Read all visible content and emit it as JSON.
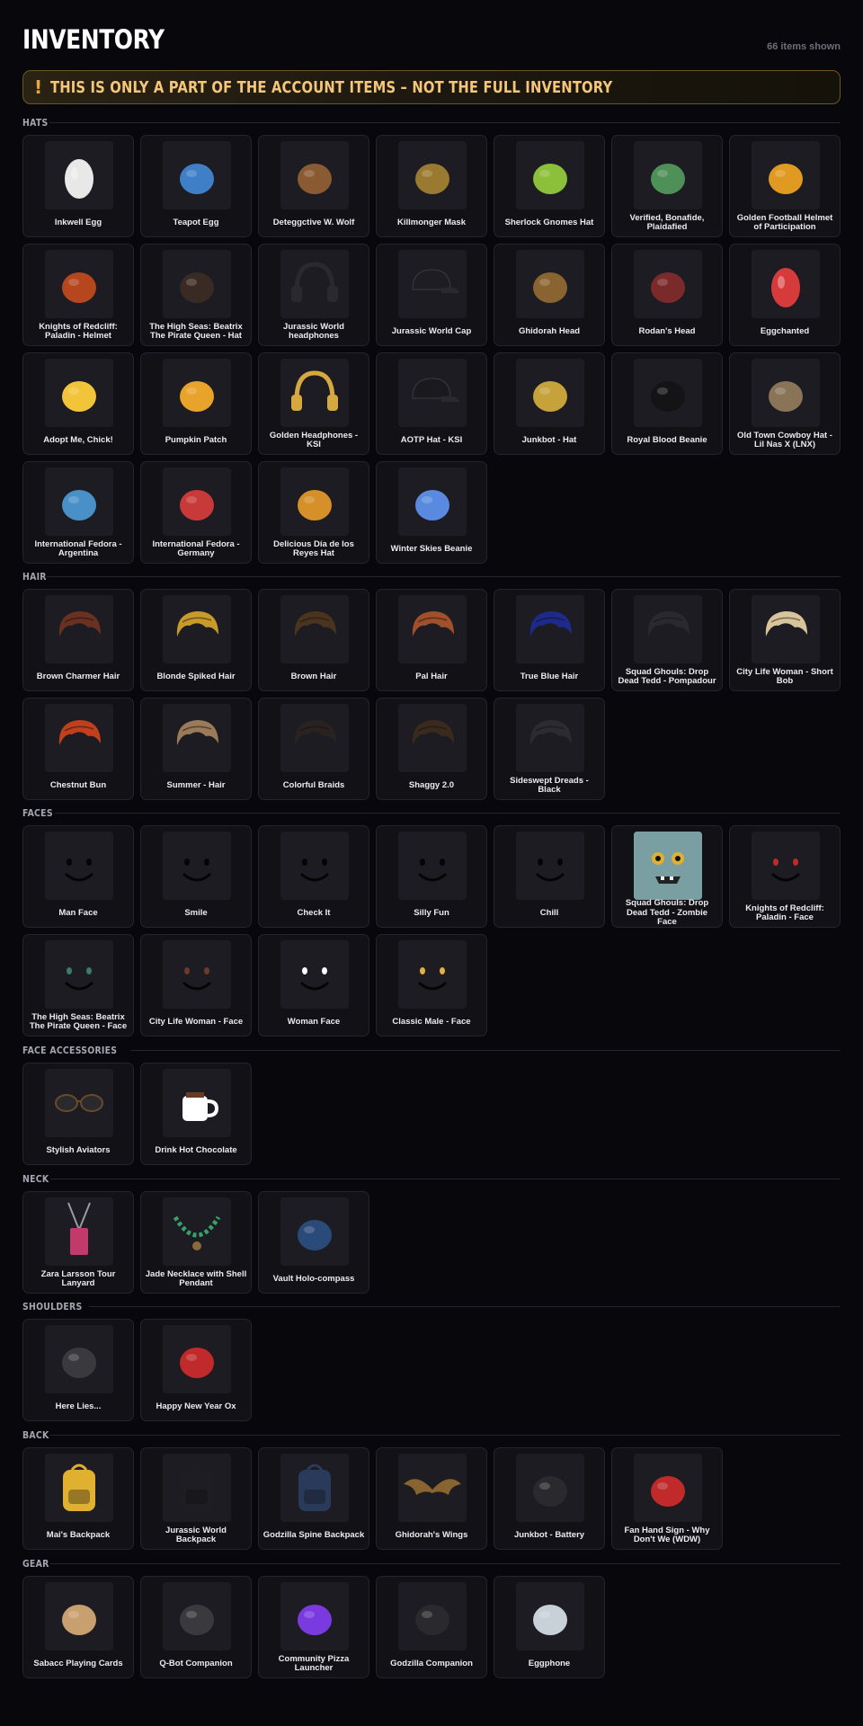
{
  "header": {
    "title": "INVENTORY",
    "count": "66 items shown"
  },
  "banner": {
    "icon": "!",
    "text": "THIS IS ONLY A PART OF THE ACCOUNT ITEMS – NOT THE FULL INVENTORY",
    "accent": "#f3c679"
  },
  "sections": [
    {
      "title": "HATS",
      "items": [
        {
          "name": "Inkwell Egg",
          "icon": "egg-icon",
          "color": "#e8e8e8"
        },
        {
          "name": "Teapot Egg",
          "icon": "teapot-icon",
          "color": "#3f7fc8"
        },
        {
          "name": "Deteggctive W. Wolf",
          "icon": "wolf-hat-icon",
          "color": "#8a5a32"
        },
        {
          "name": "Killmonger Mask",
          "icon": "mask-icon",
          "color": "#9a7a30"
        },
        {
          "name": "Sherlock Gnomes Hat",
          "icon": "gnome-hat-icon",
          "color": "#8cbf3a"
        },
        {
          "name": "Verified, Bonafide, Plaidafied",
          "icon": "plaid-cap-icon",
          "color": "#4f8f58"
        },
        {
          "name": "Golden Football Helmet of Participation",
          "icon": "helmet-icon",
          "color": "#e09a22"
        },
        {
          "name": "Knights of Redcliff: Paladin - Helmet",
          "icon": "knight-helmet-icon",
          "color": "#b5461e"
        },
        {
          "name": "The High Seas: Beatrix The Pirate Queen - Hat",
          "icon": "pirate-hat-icon",
          "color": "#3a2a24"
        },
        {
          "name": "Jurassic World headphones",
          "icon": "headphones-icon",
          "color": "#2a2a2e"
        },
        {
          "name": "Jurassic World Cap",
          "icon": "cap-icon",
          "color": "#1e1e22"
        },
        {
          "name": "Ghidorah Head",
          "icon": "dragon-head-icon",
          "color": "#8a6430"
        },
        {
          "name": "Rodan's Head",
          "icon": "creature-head-icon",
          "color": "#7a2a2a"
        },
        {
          "name": "Eggchanted",
          "icon": "egg-icon",
          "color": "#d63a3a"
        },
        {
          "name": "Adopt Me, Chick!",
          "icon": "chick-icon",
          "color": "#f2c43a"
        },
        {
          "name": "Pumpkin Patch",
          "icon": "pumpkin-icon",
          "color": "#e8a32a"
        },
        {
          "name": "Golden Headphones - KSI",
          "icon": "headphones-icon",
          "color": "#d6a840"
        },
        {
          "name": "AOTP Hat - KSI",
          "icon": "cap-icon",
          "color": "#1a1a1e"
        },
        {
          "name": "Junkbot - Hat",
          "icon": "junkbot-hat-icon",
          "color": "#c6a23a"
        },
        {
          "name": "Royal Blood Beanie",
          "icon": "beanie-icon",
          "color": "#141416"
        },
        {
          "name": "Old Town Cowboy Hat - Lil Nas X (LNX)",
          "icon": "cowboy-hat-icon",
          "color": "#8a7458"
        },
        {
          "name": "International Fedora - Argentina",
          "icon": "fedora-icon",
          "color": "#4a90c8"
        },
        {
          "name": "International Fedora - Germany",
          "icon": "fedora-icon",
          "color": "#c83a3a"
        },
        {
          "name": "Delicious Día de los Reyes Hat",
          "icon": "cake-hat-icon",
          "color": "#d6902a"
        },
        {
          "name": "Winter Skies Beanie",
          "icon": "cloud-hat-icon",
          "color": "#5a8ae0"
        }
      ]
    },
    {
      "title": "HAIR",
      "items": [
        {
          "name": "Brown Charmer Hair",
          "icon": "hair-icon",
          "color": "#6a3020"
        },
        {
          "name": "Blonde Spiked Hair",
          "icon": "hair-icon",
          "color": "#c89a2a"
        },
        {
          "name": "Brown Hair",
          "icon": "hair-icon",
          "color": "#4a3420"
        },
        {
          "name": "Pal Hair",
          "icon": "hair-icon",
          "color": "#a0502a"
        },
        {
          "name": "True Blue Hair",
          "icon": "hair-icon",
          "color": "#1e2a8a"
        },
        {
          "name": "Squad Ghouls: Drop Dead Tedd - Pompadour",
          "icon": "hair-icon",
          "color": "#2a2a2e"
        },
        {
          "name": "City Life Woman - Short Bob",
          "icon": "hair-icon",
          "color": "#d8c49a"
        },
        {
          "name": "Chestnut Bun",
          "icon": "hair-icon",
          "color": "#c0401e"
        },
        {
          "name": "Summer - Hair",
          "icon": "hair-icon",
          "color": "#9a7a58"
        },
        {
          "name": "Colorful Braids",
          "icon": "hair-icon",
          "color": "#2a2220"
        },
        {
          "name": "Shaggy 2.0",
          "icon": "hair-icon",
          "color": "#3a2a1e"
        },
        {
          "name": "Sideswept Dreads - Black",
          "icon": "hair-icon",
          "color": "#2c2c30"
        }
      ]
    },
    {
      "title": "FACES",
      "items": [
        {
          "name": "Man Face",
          "icon": "face-icon",
          "color": "#000000"
        },
        {
          "name": "Smile",
          "icon": "face-icon",
          "color": "#000000"
        },
        {
          "name": "Check It",
          "icon": "face-icon",
          "color": "#000000"
        },
        {
          "name": "Silly Fun",
          "icon": "face-icon",
          "color": "#000000"
        },
        {
          "name": "Chill",
          "icon": "face-icon",
          "color": "#000000"
        },
        {
          "name": "Squad Ghouls: Drop Dead Tedd - Zombie Face",
          "icon": "zombie-face-icon",
          "color": "#7a9fa3"
        },
        {
          "name": "Knights of Redcliff: Paladin - Face",
          "icon": "face-icon",
          "color": "#c02a2a"
        },
        {
          "name": "The High Seas: Beatrix The Pirate Queen - Face",
          "icon": "face-icon",
          "color": "#3a7a6a"
        },
        {
          "name": "City Life Woman - Face",
          "icon": "face-icon",
          "color": "#6a3a2a"
        },
        {
          "name": "Woman Face",
          "icon": "face-icon",
          "color": "#ffffff"
        },
        {
          "name": "Classic Male - Face",
          "icon": "face-icon",
          "color": "#e0b040"
        }
      ]
    },
    {
      "title": "FACE ACCESSORIES",
      "items": [
        {
          "name": "Stylish Aviators",
          "icon": "sunglasses-icon",
          "color": "#6a4a2a"
        },
        {
          "name": "Drink Hot Chocolate",
          "icon": "mug-icon",
          "color": "#ffffff"
        }
      ]
    },
    {
      "title": "NECK",
      "items": [
        {
          "name": "Zara Larsson Tour Lanyard",
          "icon": "lanyard-icon",
          "color": "#c03a6a"
        },
        {
          "name": "Jade Necklace with Shell Pendant",
          "icon": "necklace-icon",
          "color": "#3aa06a"
        },
        {
          "name": "Vault Holo-compass",
          "icon": "compass-icon",
          "color": "#2a4a7a"
        }
      ]
    },
    {
      "title": "SHOULDERS",
      "items": [
        {
          "name": "Here Lies...",
          "icon": "tombstone-icon",
          "color": "#3a3a3e"
        },
        {
          "name": "Happy New Year Ox",
          "icon": "ox-icon",
          "color": "#c02a2a"
        }
      ]
    },
    {
      "title": "BACK",
      "items": [
        {
          "name": "Mai's Backpack",
          "icon": "backpack-icon",
          "color": "#e0b030"
        },
        {
          "name": "Jurassic World Backpack",
          "icon": "backpack-icon",
          "color": "#1e1e22"
        },
        {
          "name": "Godzilla Spine Backpack",
          "icon": "backpack-icon",
          "color": "#2a3a5a"
        },
        {
          "name": "Ghidorah's Wings",
          "icon": "wings-icon",
          "color": "#8a6430"
        },
        {
          "name": "Junkbot - Battery",
          "icon": "battery-icon",
          "color": "#2a2a2e"
        },
        {
          "name": "Fan Hand Sign - Why Don't We (WDW)",
          "icon": "foam-hand-icon",
          "color": "#c02a2a"
        }
      ]
    },
    {
      "title": "GEAR",
      "items": [
        {
          "name": "Sabacc Playing Cards",
          "icon": "cards-icon",
          "color": "#c8a070"
        },
        {
          "name": "Q-Bot Companion",
          "icon": "robot-icon",
          "color": "#3a3a3e"
        },
        {
          "name": "Community Pizza Launcher",
          "icon": "launcher-icon",
          "color": "#7a3ae0"
        },
        {
          "name": "Godzilla Companion",
          "icon": "godzilla-icon",
          "color": "#2a2a2e"
        },
        {
          "name": "Eggphone",
          "icon": "phone-icon",
          "color": "#c8d0d8"
        }
      ]
    }
  ]
}
